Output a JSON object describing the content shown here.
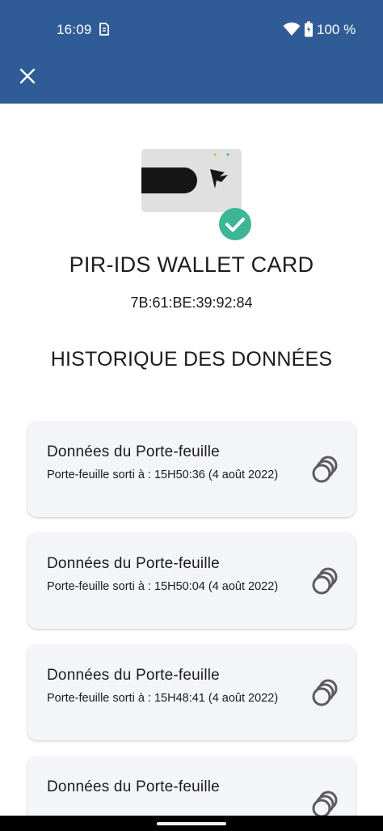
{
  "status_bar": {
    "time": "16:09",
    "battery_text": "100 %"
  },
  "app_bar": {
    "close_icon": "close-icon",
    "background_color": "#2f5c96"
  },
  "device": {
    "name": "PIR-IDS WALLET CARD",
    "id": "7B:61:BE:39:92:84",
    "status_icon": "check-circle-icon",
    "status_color": "#3db596"
  },
  "history": {
    "title": "HISTORIQUE DES DONNÉES",
    "items": [
      {
        "title": "Données du Porte-feuille",
        "subtitle": "Porte-feuille sorti à : 15H50:36 (4 août 2022)",
        "icon": "coins-icon"
      },
      {
        "title": "Données du Porte-feuille",
        "subtitle": "Porte-feuille sorti à : 15H50:04 (4 août 2022)",
        "icon": "coins-icon"
      },
      {
        "title": "Données du Porte-feuille",
        "subtitle": "Porte-feuille sorti à : 15H48:41 (4 août 2022)",
        "icon": "coins-icon"
      },
      {
        "title": "Données du Porte-feuille",
        "subtitle": "",
        "icon": "coins-icon"
      }
    ]
  }
}
